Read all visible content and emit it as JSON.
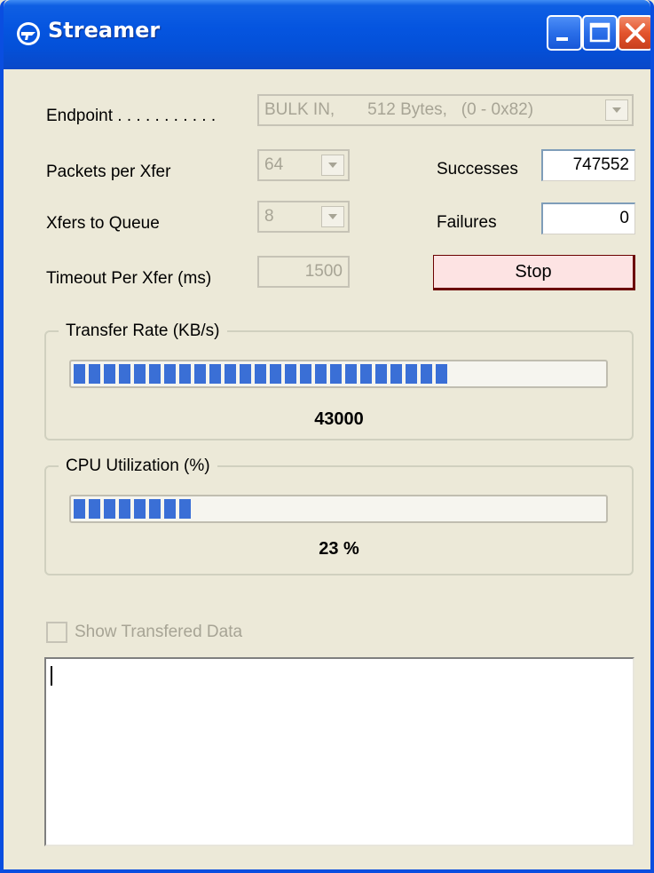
{
  "window": {
    "title": "Streamer",
    "title_icon": "cypress-logo-icon",
    "controls": [
      "minimize-icon",
      "maximize-icon",
      "close-icon"
    ]
  },
  "settings": {
    "endpoint_label": "Endpoint . . . . . . . . . . .",
    "endpoint_value": "BULK IN,       512 Bytes,   (0 - 0x82)",
    "packets_label": "Packets per Xfer",
    "packets_value": "64",
    "xfers_label": "Xfers to Queue",
    "xfers_value": "8",
    "timeout_label": "Timeout Per Xfer (ms)",
    "timeout_value": "1500"
  },
  "stats": {
    "successes_label": "Successes",
    "successes_value": "747552",
    "failures_label": "Failures",
    "failures_value": "0"
  },
  "controls": {
    "stop_label": "Stop"
  },
  "transfer_rate": {
    "title": "Transfer Rate (KB/s)",
    "value_text": "43000",
    "fill_fraction": 0.72
  },
  "cpu": {
    "title": "CPU Utilization (%)",
    "value_text": "23 %",
    "fill_fraction": 0.23
  },
  "show_data": {
    "label": "Show Transfered Data",
    "checked": false
  },
  "colors": {
    "titlebar": "#0555e0",
    "progress_fill": "#3a6fd6",
    "stop_button_bg": "#fde3e3"
  }
}
